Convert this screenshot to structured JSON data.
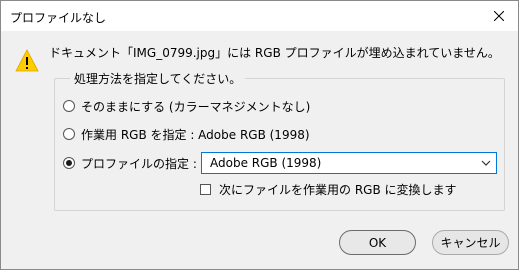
{
  "window": {
    "title": "プロファイルなし",
    "close_icon": "close-icon"
  },
  "message": "ドキュメント「IMG_0799.jpg」には RGB プロファイルが埋め込まれていません。",
  "group": {
    "legend": "処理方法を指定してください。",
    "options": [
      {
        "label": "そのままにする (カラーマネジメントなし)",
        "checked": false
      },
      {
        "label": "作業用 RGB を指定 : Adobe RGB (1998)",
        "checked": false
      },
      {
        "label": "プロファイルの指定 :",
        "checked": true
      }
    ],
    "profile_select": {
      "value": "Adobe RGB (1998)"
    },
    "convert_checkbox": {
      "label": "次にファイルを作業用の RGB に変換します",
      "checked": false
    }
  },
  "buttons": {
    "ok": "OK",
    "cancel": "キャンセル"
  },
  "colors": {
    "select_border": "#0078d7",
    "warning_yellow": "#ffcc00"
  }
}
